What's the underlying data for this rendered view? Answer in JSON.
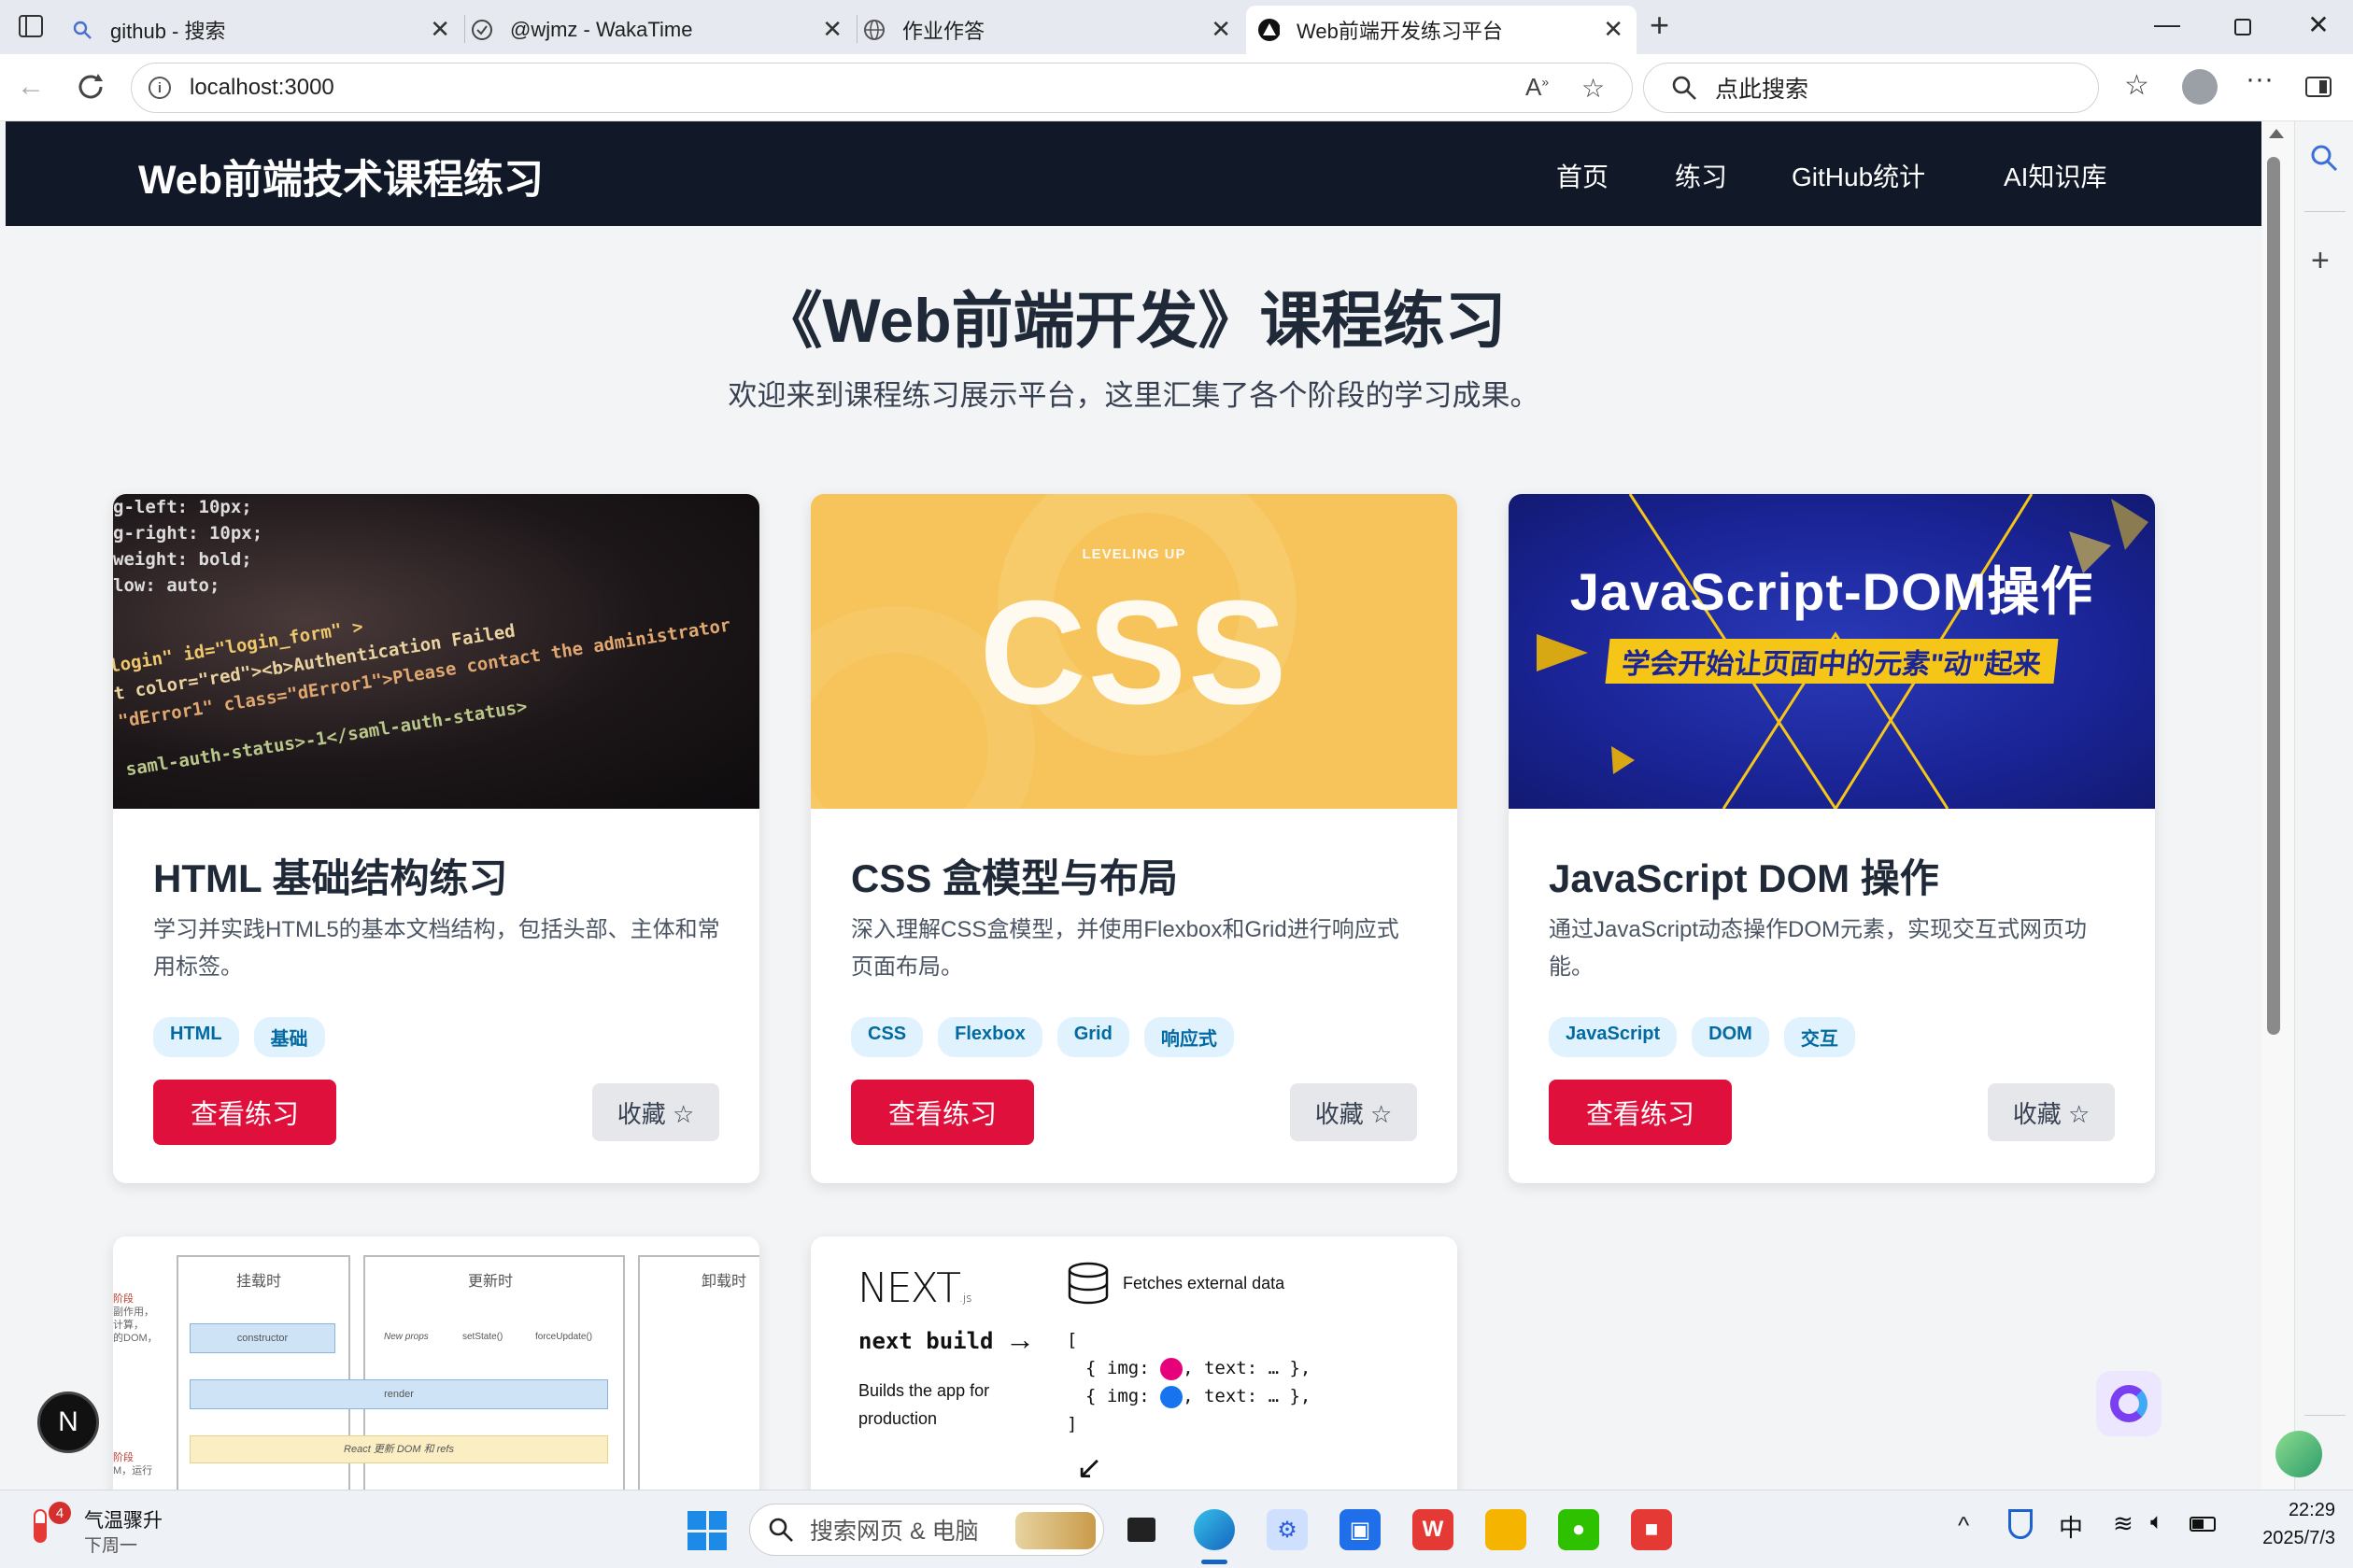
{
  "browser": {
    "tabs": [
      {
        "title": "github - 搜索",
        "icon": "search-icon"
      },
      {
        "title": "@wjmz - WakaTime",
        "icon": "wakatime-icon"
      },
      {
        "title": "作业作答",
        "icon": "globe-icon"
      },
      {
        "title": "Web前端开发练习平台",
        "icon": "nextjs-icon",
        "active": true
      }
    ],
    "url": "localhost:3000",
    "search_placeholder": "点此搜索"
  },
  "site": {
    "logo": "Web前端技术课程练习",
    "nav": [
      "首页",
      "练习",
      "GitHub统计",
      "AI知识库"
    ],
    "hero_title": "《Web前端开发》课程练习",
    "hero_subtitle": "欢迎来到课程练习展示平台，这里汇集了各个阶段的学习成果。"
  },
  "cards": [
    {
      "title": "HTML 基础结构练习",
      "desc": "学习并实践HTML5的基本文档结构，包括头部、主体和常用标签。",
      "tags": [
        "HTML",
        "基础"
      ],
      "view_label": "查看练习",
      "fav_label": "收藏 ☆",
      "image": {
        "code_lines": [
          "g-left: 10px;",
          "g-right: 10px;",
          "weight: bold;",
          "low: auto;",
          "login\" id=\"login_form\" >",
          "t color=\"red\"><b>Authentication Failed",
          "\"dError1\" class=\"dError1\">Please contact the administrator",
          "saml-auth-status>-1</saml-auth-status>"
        ]
      }
    },
    {
      "title": "CSS 盒模型与布局",
      "desc": "深入理解CSS盒模型，并使用Flexbox和Grid进行响应式页面布局。",
      "tags": [
        "CSS",
        "Flexbox",
        "Grid",
        "响应式"
      ],
      "view_label": "查看练习",
      "fav_label": "收藏 ☆",
      "image": {
        "small": "LEVELING UP",
        "big": "CSS"
      }
    },
    {
      "title": "JavaScript DOM 操作",
      "desc": "通过JavaScript动态操作DOM元素，实现交互式网页功能。",
      "tags": [
        "JavaScript",
        "DOM",
        "交互"
      ],
      "view_label": "查看练习",
      "fav_label": "收藏 ☆",
      "image": {
        "big": "JavaScript-DOM操作",
        "banner": "学会开始让页面中的元素\"动\"起来"
      }
    }
  ],
  "lower_cards": {
    "react": {
      "col1": "挂载时",
      "col2": "更新时",
      "col3": "卸载时",
      "box1": "constructor",
      "box2": "New props",
      "box3": "setState()",
      "box4": "forceUpdate()",
      "box5": "render",
      "box6": "React 更新 DOM 和 refs",
      "side1": "阶段",
      "side2": "副作用，",
      "side3": "计算，",
      "side4": "的DOM，",
      "side5": "阶段",
      "side6": "M，运行"
    },
    "next": {
      "logo": "NEXT",
      "logo_sub": ".js",
      "cmd": "next build",
      "fetch": "Fetches external data",
      "desc": "Builds the app for production",
      "line1_a": "{ img:",
      "line1_b": ", text: … },",
      "line2_a": "{ img:",
      "line2_b": ", text: … },",
      "bracket_open": "[",
      "bracket_close": "]",
      "arrow1": "→",
      "arrow2": "↙"
    }
  },
  "floating": {
    "next_badge": "N"
  },
  "taskbar": {
    "weather_title": "气温骤升",
    "weather_sub": "下周一",
    "weather_badge": "4",
    "search_placeholder": "搜索网页 & 电脑",
    "ime": "中",
    "time": "22:29",
    "date": "2025/7/3"
  },
  "colors": {
    "accent": "#e0103c",
    "header_bg": "#111827",
    "tag_bg": "#e0f2fe",
    "tag_text": "#0369a1"
  }
}
